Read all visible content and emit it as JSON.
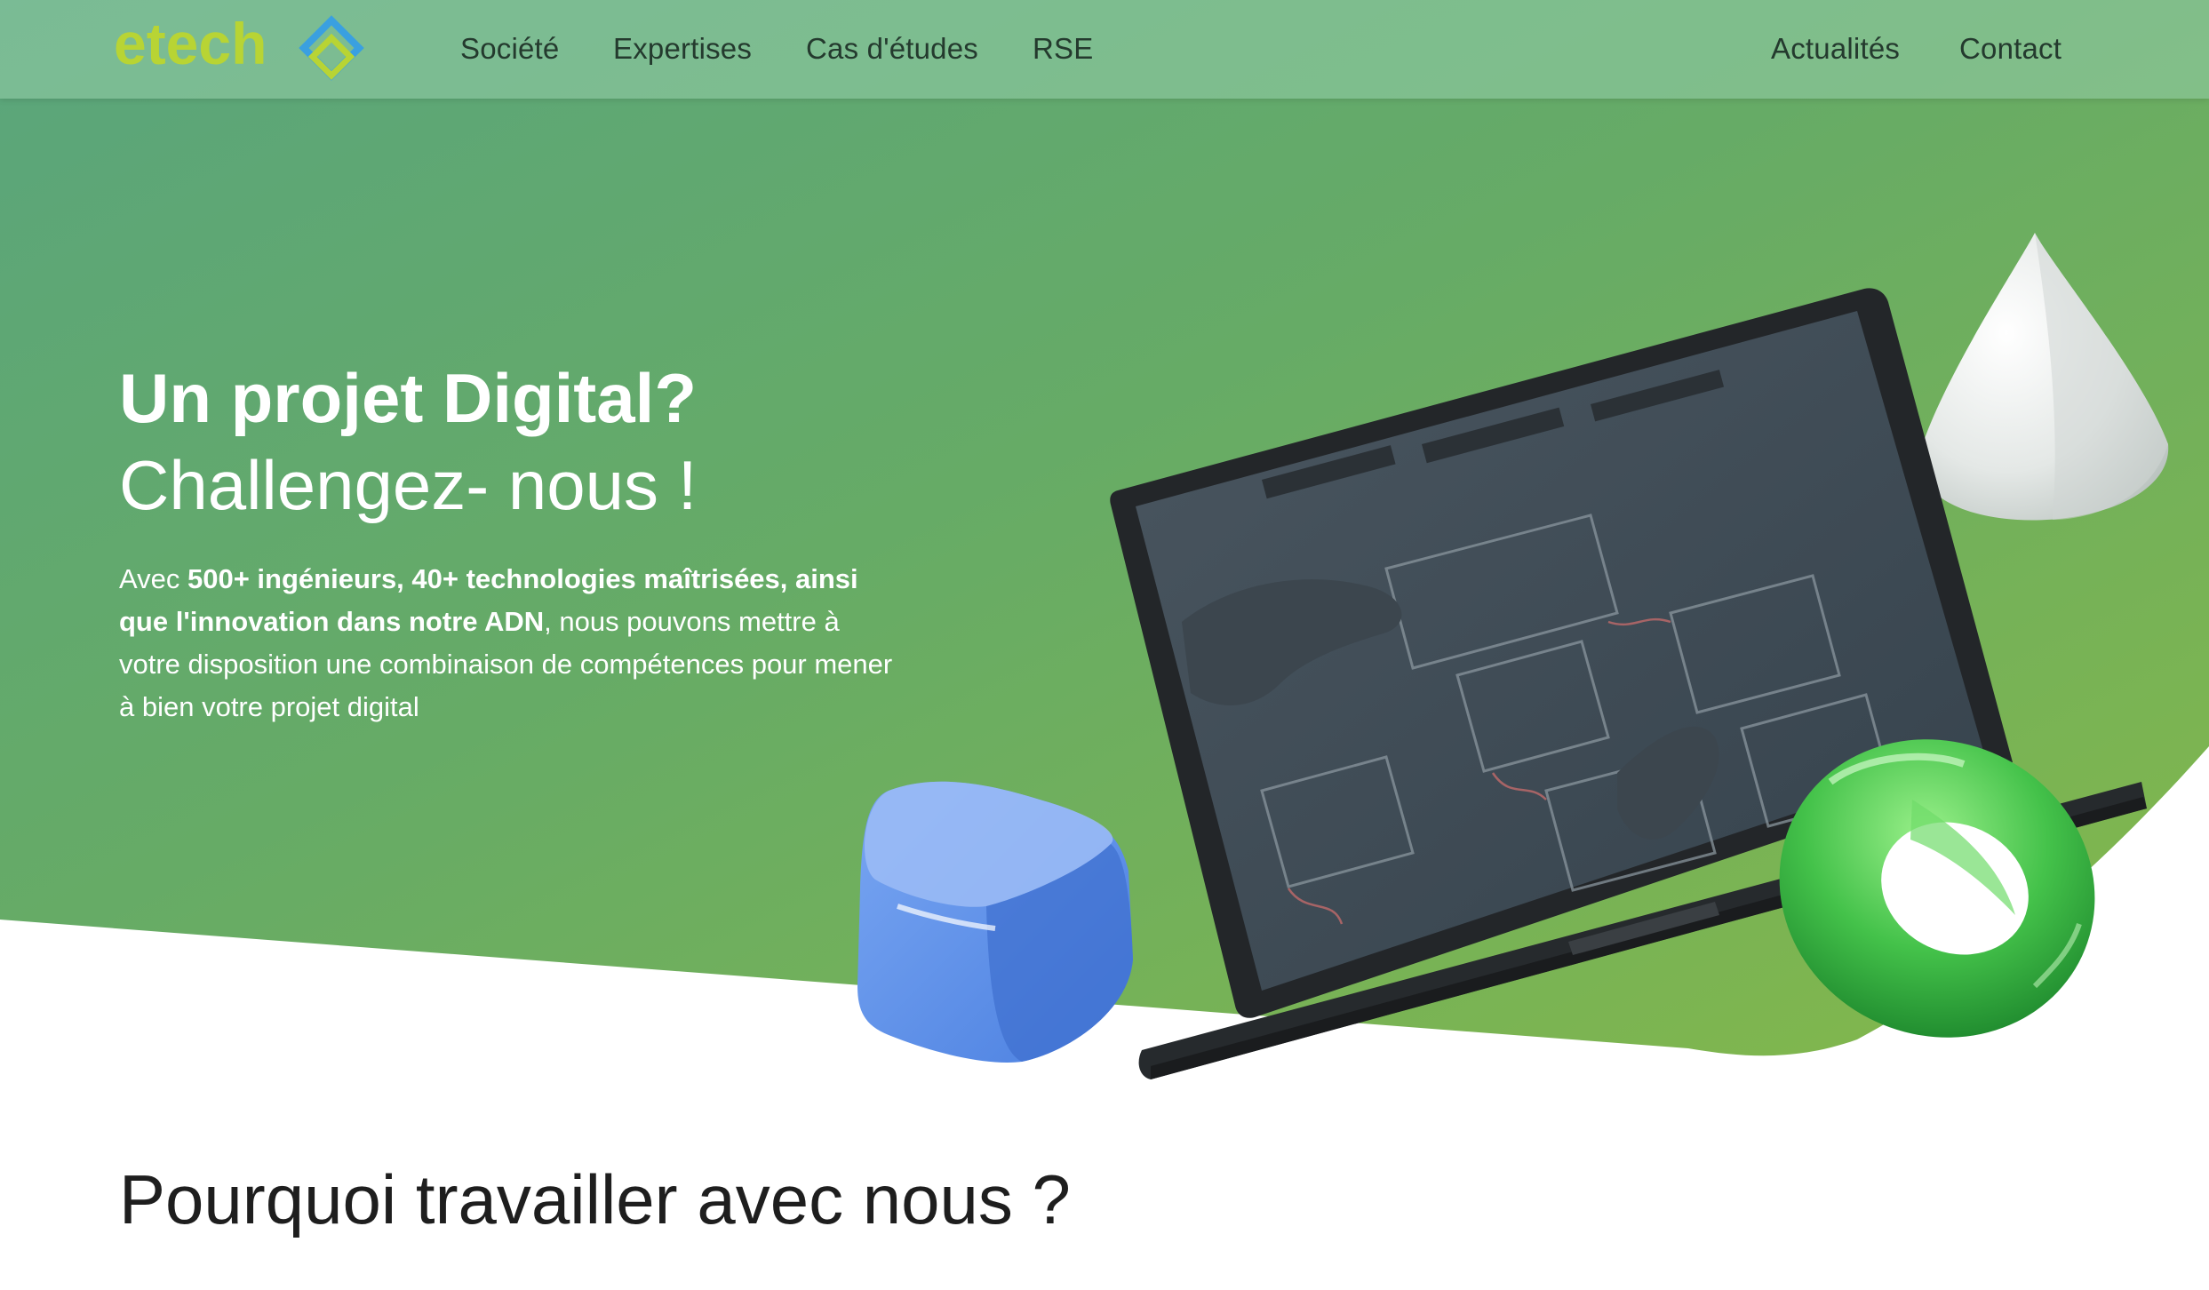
{
  "brand": {
    "logo_text": "etech",
    "colors": {
      "logo_text": "#b8d434",
      "logo_mark": "#3aa0e0",
      "hero_green": "#6aae5a",
      "nav_text": "#243a2e"
    }
  },
  "nav": {
    "left_links": [
      "Société",
      "Expertises",
      "Cas d'études",
      "RSE"
    ],
    "right_links": [
      "Actualités",
      "Contact"
    ]
  },
  "hero": {
    "title": "Un projet Digital?",
    "subtitle": "Challengez- nous !",
    "desc": {
      "p1": "Avec ",
      "b1": "500+ ingénieurs, 40+ technologies maîtrisées, ainsi que l'innovation dans notre ADN",
      "p2": ", nous pouvons mettre à votre disposition une combinaison de compétences pour mener à bien votre projet digital"
    }
  },
  "illustration_icons": [
    "laptop-icon",
    "cube-icon",
    "cone-icon",
    "torus-icon"
  ],
  "section": {
    "title": "Pourquoi travailler avec nous ?"
  }
}
